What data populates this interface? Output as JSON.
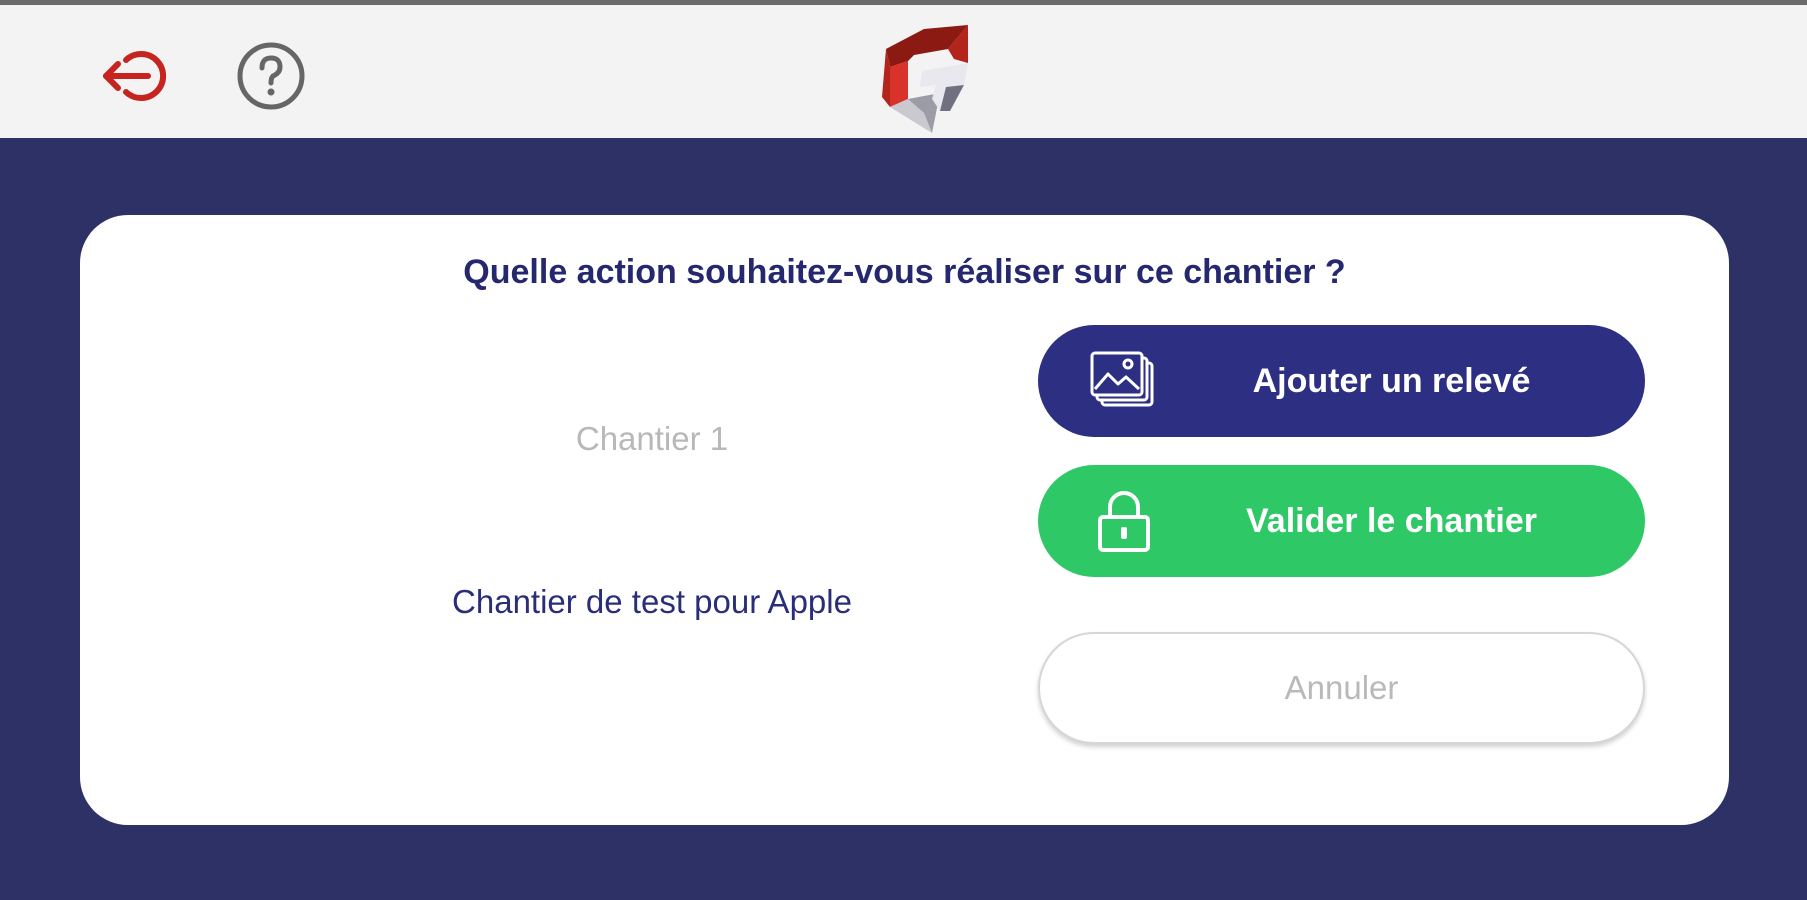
{
  "header": {
    "logout_icon": "logout-arrow-icon",
    "help_icon": "question-circle-icon",
    "logo": "app-logo"
  },
  "dialog": {
    "title": "Quelle action souhaitez-vous réaliser sur ce chantier ?",
    "site_name": "Chantier 1",
    "site_description": "Chantier de test pour Apple",
    "buttons": {
      "add": {
        "label": "Ajouter un relevé",
        "icon": "image-stack-icon"
      },
      "validate": {
        "label": "Valider le chantier",
        "icon": "lock-icon"
      },
      "cancel": {
        "label": "Annuler"
      }
    }
  },
  "colors": {
    "background": "#2e3166",
    "primary": "#2d2f83",
    "success": "#2ec867",
    "title": "#25286f",
    "logout": "#c7231f"
  }
}
